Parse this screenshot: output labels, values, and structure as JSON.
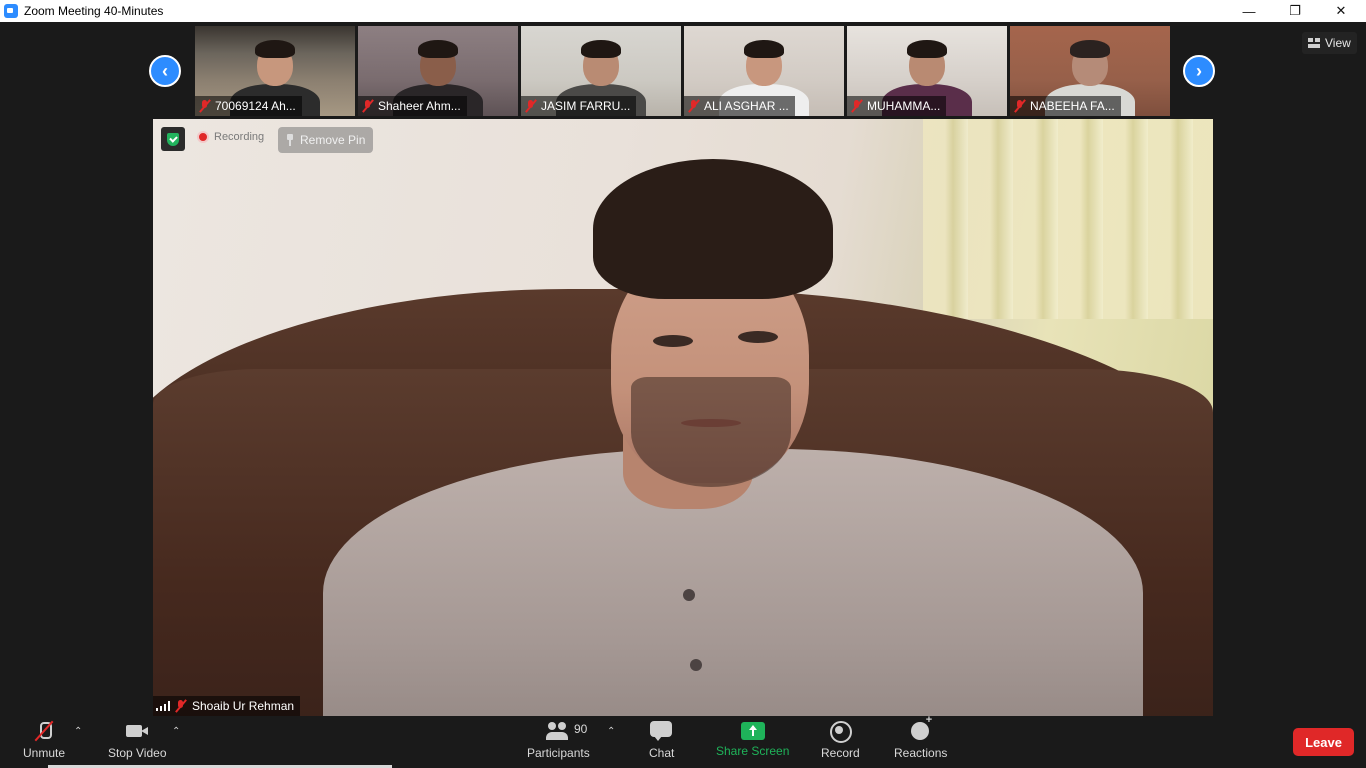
{
  "window": {
    "title": "Zoom Meeting 40-Minutes"
  },
  "top_bar": {
    "view_label": "View",
    "thumbnails": [
      {
        "name": "70069124 Ah...",
        "muted": true
      },
      {
        "name": "Shaheer Ahm...",
        "muted": true
      },
      {
        "name": "JASIM FARRU...",
        "muted": true
      },
      {
        "name": "ALI ASGHAR ...",
        "muted": true
      },
      {
        "name": "MUHAMMA...",
        "muted": true
      },
      {
        "name": "NABEEHA FA...",
        "muted": true
      }
    ]
  },
  "main_video": {
    "recording_label": "Recording",
    "remove_pin_label": "Remove Pin",
    "speaker_name": "Shoaib Ur Rehman"
  },
  "toolbar": {
    "unmute_label": "Unmute",
    "stop_video_label": "Stop Video",
    "participants_label": "Participants",
    "participants_count": "90",
    "chat_label": "Chat",
    "share_screen_label": "Share Screen",
    "record_label": "Record",
    "reactions_label": "Reactions",
    "leave_label": "Leave"
  },
  "colors": {
    "accent": "#2d8cff",
    "share_green": "#1fb35a",
    "leave_red": "#e02828",
    "background": "#1a1a1a"
  },
  "icons": [
    "zoom-app-icon",
    "minimize-icon",
    "restore-icon",
    "close-icon",
    "chevron-left-icon",
    "chevron-right-icon",
    "grid-view-icon",
    "muted-mic-icon",
    "security-shield-icon",
    "recording-dot-icon",
    "pin-icon",
    "signal-icon",
    "microphone-icon",
    "video-camera-icon",
    "participants-icon",
    "chat-icon",
    "share-screen-icon",
    "record-icon",
    "reactions-icon"
  ]
}
